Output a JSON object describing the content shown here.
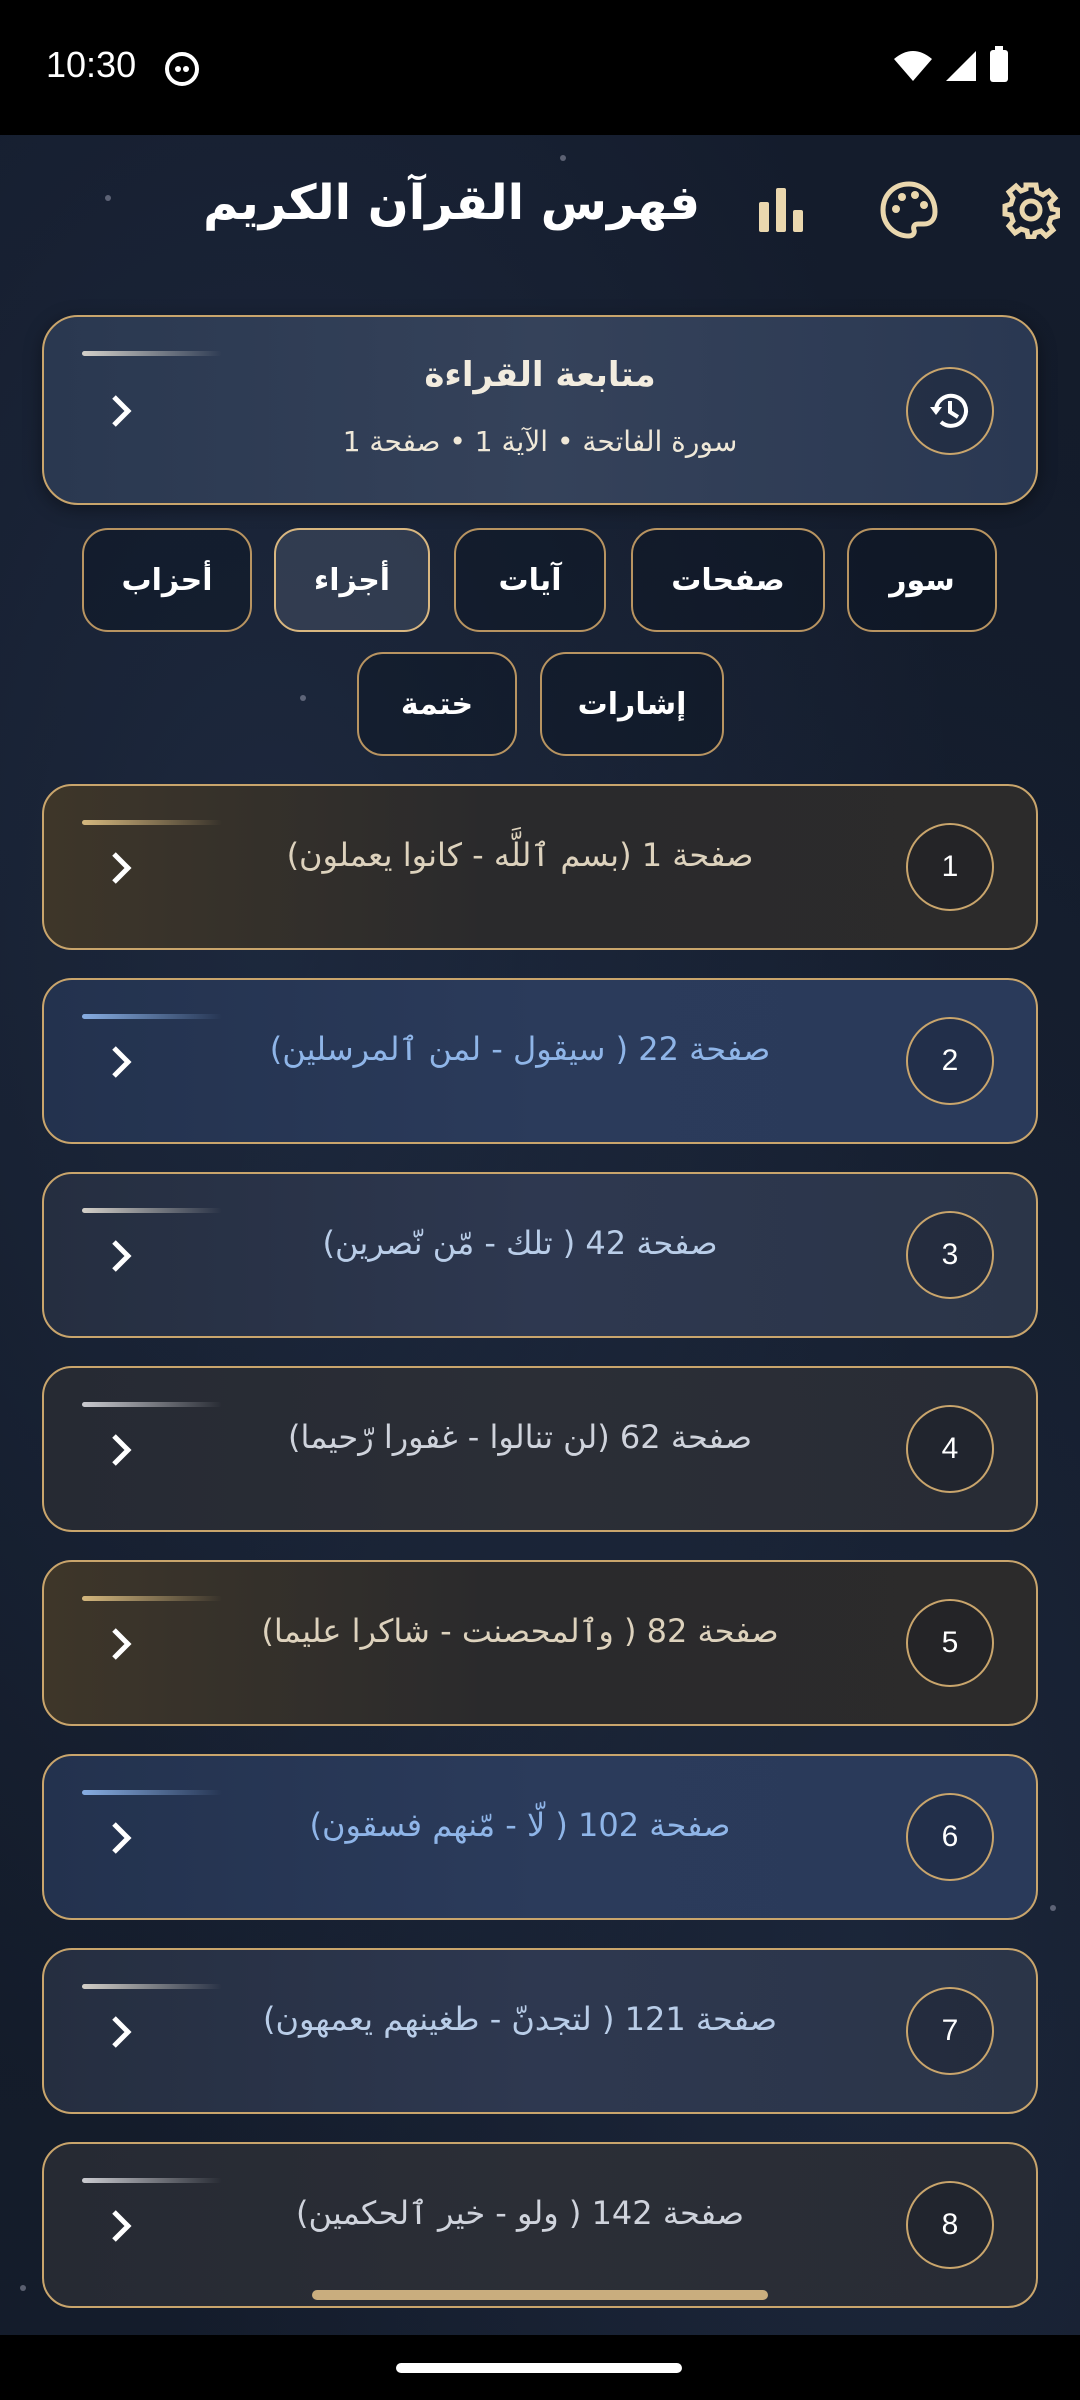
{
  "status_bar": {
    "time": "10:30",
    "icons": [
      "cat-notification-icon",
      "wifi-icon",
      "signal-icon",
      "battery-icon"
    ]
  },
  "header": {
    "title": "فهرس القرآن الكريم",
    "icons": [
      "stats-icon",
      "palette-icon",
      "settings-icon"
    ]
  },
  "continue_reading": {
    "title": "متابعة القراءة",
    "subtitle": "سورة الفاتحة • الآية 1 • صفحة 1",
    "icon": "history-icon"
  },
  "filters": [
    {
      "label": "سور",
      "active": false
    },
    {
      "label": "صفحات",
      "active": false
    },
    {
      "label": "آيات",
      "active": false
    },
    {
      "label": "أجزاء",
      "active": true
    },
    {
      "label": "أحزاب",
      "active": false
    },
    {
      "label": "إشارات",
      "active": false
    },
    {
      "label": "ختمة",
      "active": false
    }
  ],
  "juz_list": [
    {
      "number": "1",
      "label": "صفحة 1 (بسم ٱللَّه - كانوا يعملون)"
    },
    {
      "number": "2",
      "label": "صفحة 22 ( سيقول - لمن ٱلمرسلين)"
    },
    {
      "number": "3",
      "label": "صفحة 42 ( تلك - مّن نّصرين)"
    },
    {
      "number": "4",
      "label": "صفحة 62 (لن تنالوا - غفورا رّحيما)"
    },
    {
      "number": "5",
      "label": "صفحة 82 ( وٱلمحصنت - شاكرا عليما)"
    },
    {
      "number": "6",
      "label": "صفحة 102 ( لّا - مّنهم فسقون)"
    },
    {
      "number": "7",
      "label": "صفحة 121 ( لتجدنّ - طغينهم يعمهون)"
    },
    {
      "number": "8",
      "label": "صفحة 142 ( ولو - خير ٱلحكمين)"
    }
  ],
  "colors": {
    "background": "#141c2c",
    "accent_gold": "#c9a56c",
    "text_blue": "#8fb5e8"
  }
}
